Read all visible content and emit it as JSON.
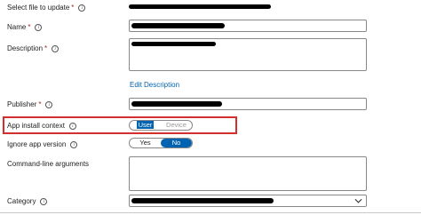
{
  "form": {
    "select_file": {
      "label": "Select file to update",
      "required_mark": "*"
    },
    "name": {
      "label": "Name",
      "required_mark": "*"
    },
    "description": {
      "label": "Description",
      "required_mark": "*"
    },
    "edit_description": "Edit Description",
    "publisher": {
      "label": "Publisher",
      "required_mark": "*"
    },
    "install_context": {
      "label": "App install context",
      "options": [
        "User",
        "Device"
      ],
      "selected": "User"
    },
    "ignore_version": {
      "label": "Ignore app version",
      "options": [
        "Yes",
        "No"
      ],
      "selected": "No"
    },
    "cmdline": {
      "label": "Command-line arguments"
    },
    "category": {
      "label": "Category"
    }
  },
  "info_glyph": "i",
  "colors": {
    "accent": "#0063b1",
    "highlight": "#d32f2f",
    "required": "#a4262c"
  }
}
